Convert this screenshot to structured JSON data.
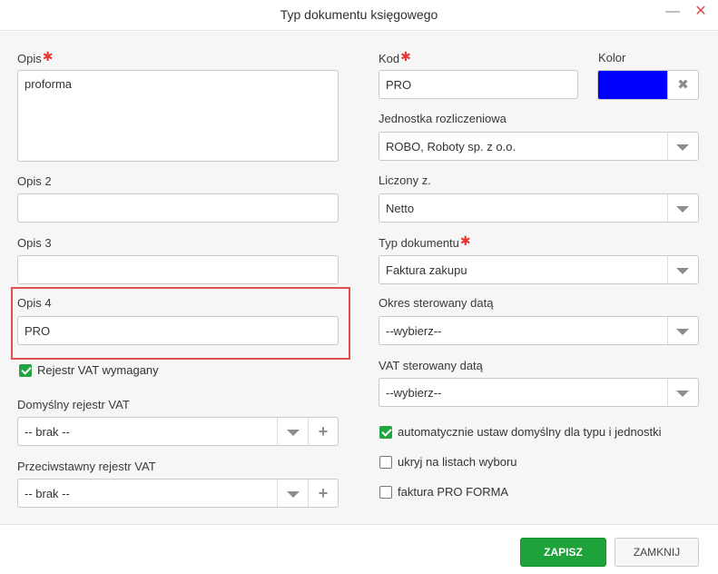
{
  "window": {
    "title": "Typ dokumentu księgowego",
    "minimize_icon": "minimize-icon",
    "close_icon": "close-icon"
  },
  "form": {
    "opis": {
      "label": "Opis",
      "required_mark": "✱",
      "value": "proforma"
    },
    "opis2": {
      "label": "Opis 2",
      "value": ""
    },
    "opis3": {
      "label": "Opis 3",
      "value": ""
    },
    "opis4": {
      "label": "Opis 4",
      "value": "PRO"
    },
    "rejestr_vat_wymagany": {
      "label": "Rejestr VAT wymagany",
      "checked": true
    },
    "domyslny_rejestr": {
      "label": "Domyślny rejestr VAT",
      "value": "-- brak --"
    },
    "przeciwstawny_rejestr": {
      "label": "Przeciwstawny rejestr VAT",
      "value": "-- brak --"
    },
    "kod": {
      "label": "Kod",
      "required_mark": "✱",
      "value": "PRO"
    },
    "kolor": {
      "label": "Kolor",
      "value": "#0000ff",
      "clear_glyph": "✖"
    },
    "jednostka": {
      "label": "Jednostka rozliczeniowa",
      "value": "ROBO, Roboty sp. z o.o."
    },
    "liczony": {
      "label": "Liczony z.",
      "value": "Netto"
    },
    "typ_dokumentu": {
      "label": "Typ dokumentu",
      "required_mark": "✱",
      "value": "Faktura zakupu"
    },
    "okres_sterowany": {
      "label": "Okres sterowany datą",
      "value": "--wybierz--"
    },
    "vat_sterowany": {
      "label": "VAT sterowany datą",
      "value": "--wybierz--"
    },
    "auto_domyslny": {
      "label": "automatycznie ustaw domyślny dla typu i jednostki",
      "checked": true
    },
    "ukryj": {
      "label": "ukryj na listach wyboru",
      "checked": false
    },
    "faktura_proforma": {
      "label": "faktura PRO FORMA",
      "checked": false
    },
    "plus_glyph": "+"
  },
  "buttons": {
    "save": "ZAPISZ",
    "close": "ZAMKNIJ"
  },
  "colors": {
    "accent_green": "#1ea33a",
    "highlight_red": "#e0504d",
    "required_red": "#e53935"
  }
}
